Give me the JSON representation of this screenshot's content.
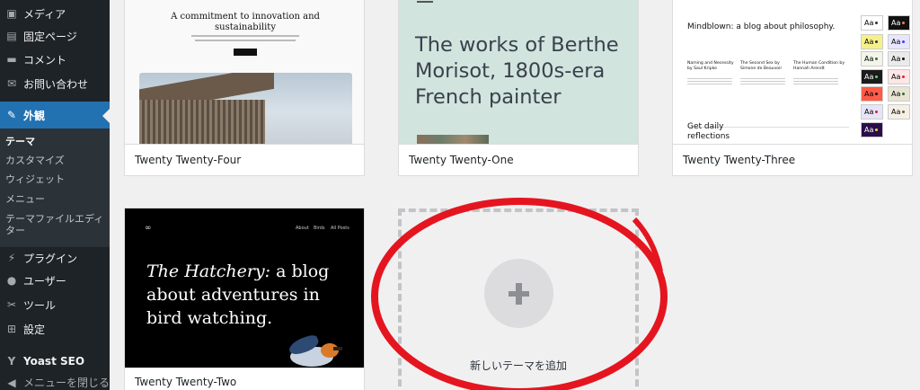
{
  "sidebar": {
    "items": [
      {
        "label": "メディア",
        "icon": "media-icon"
      },
      {
        "label": "固定ページ",
        "icon": "page-icon"
      },
      {
        "label": "コメント",
        "icon": "comment-icon"
      },
      {
        "label": "お問い合わせ",
        "icon": "mail-icon"
      },
      {
        "label": "外観",
        "icon": "paintbrush-icon"
      },
      {
        "label": "プラグイン",
        "icon": "plugin-icon"
      },
      {
        "label": "ユーザー",
        "icon": "user-icon"
      },
      {
        "label": "ツール",
        "icon": "wrench-icon"
      },
      {
        "label": "設定",
        "icon": "settings-icon"
      },
      {
        "label": "Yoast SEO",
        "icon": "yoast-icon"
      },
      {
        "label": "メニューを閉じる",
        "icon": "collapse-icon"
      }
    ],
    "submenu": [
      "テーマ",
      "カスタマイズ",
      "ウィジェット",
      "メニュー",
      "テーマファイルエディター"
    ]
  },
  "themes": {
    "four": {
      "name": "Twenty Twenty-Four",
      "heading": "A commitment to innovation and sustainability"
    },
    "one": {
      "name": "Twenty Twenty-One",
      "heading": "The works of Berthe Morisot, 1800s-era French painter"
    },
    "three": {
      "name": "Twenty Twenty-Three",
      "heading": "Mindblown: a blog about philosophy.",
      "posts": [
        {
          "title": "Naming and Necessity by Saul Kripke"
        },
        {
          "title": "The Second Sex by Simone de Beauvoir"
        },
        {
          "title": "The Human Condition by Hannah Arendt"
        }
      ],
      "footer": "Get daily reflections",
      "swatch_label": "Aa"
    },
    "two": {
      "name": "Twenty Twenty-Two",
      "nav": [
        "About",
        "Birds",
        "All Posts"
      ],
      "heading_italic": "The Hatchery:",
      "heading_rest": " a blog about adventures in bird watching."
    }
  },
  "add_new": {
    "label": "新しいテーマを追加",
    "icon": "plus-icon"
  },
  "colors": {
    "accent": "#2271b1",
    "annotation": "#e5151f"
  }
}
